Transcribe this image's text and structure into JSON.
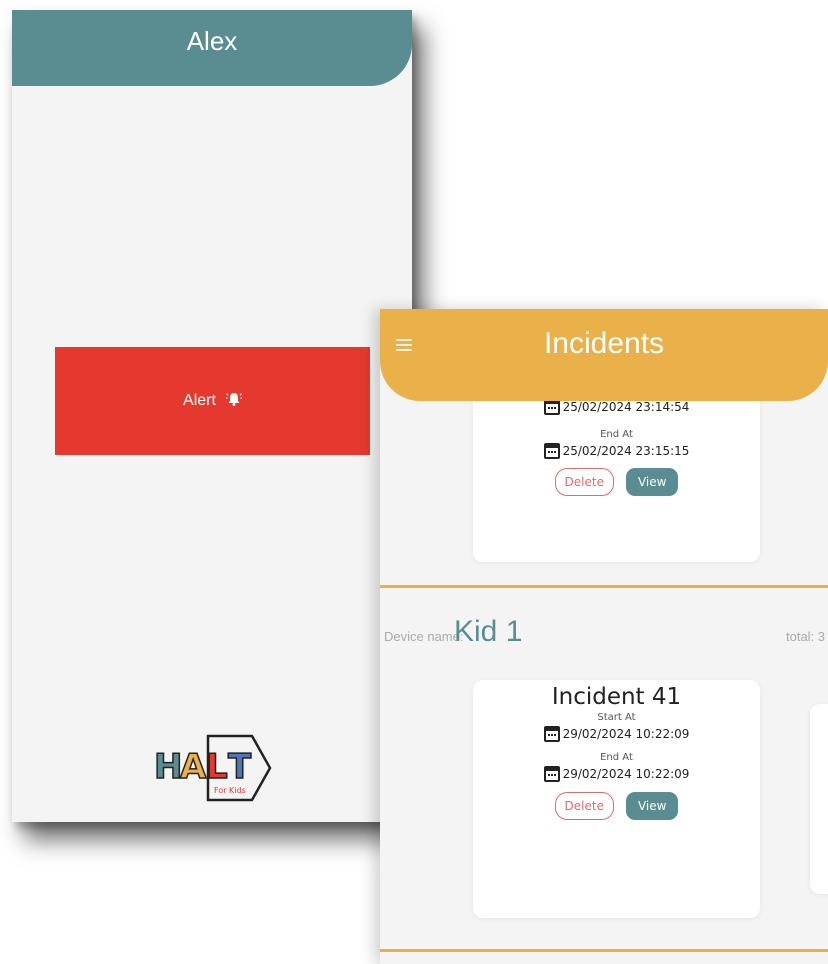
{
  "phone1": {
    "title": "Alex",
    "alert_label": "Alert",
    "alert_icon": "bell-alert-icon",
    "logo": {
      "text": "HALT",
      "tagline": "For Kids"
    },
    "colors": {
      "header": "#5a8d92",
      "alert": "#e5392f",
      "background": "#f4f4f4"
    }
  },
  "phone2": {
    "title": "Incidents",
    "menu_icon": "hamburger-menu-icon",
    "colors": {
      "header": "#eab14a",
      "accent": "#5a8d92",
      "delete": "#e06b6b"
    },
    "top_card": {
      "start_value": "25/02/2024 23:14:54",
      "end_caption": "End At",
      "end_value": "25/02/2024 23:15:15",
      "delete_label": "Delete",
      "view_label": "View"
    },
    "device": {
      "label": "Device name:",
      "name": "Kid 1",
      "total_label": "total: 3"
    },
    "incident": {
      "title": "Incident 41",
      "start_caption": "Start At",
      "start_value": "29/02/2024 10:22:09",
      "end_caption": "End At",
      "end_value": "29/02/2024 10:22:09",
      "delete_label": "Delete",
      "view_label": "View"
    }
  }
}
